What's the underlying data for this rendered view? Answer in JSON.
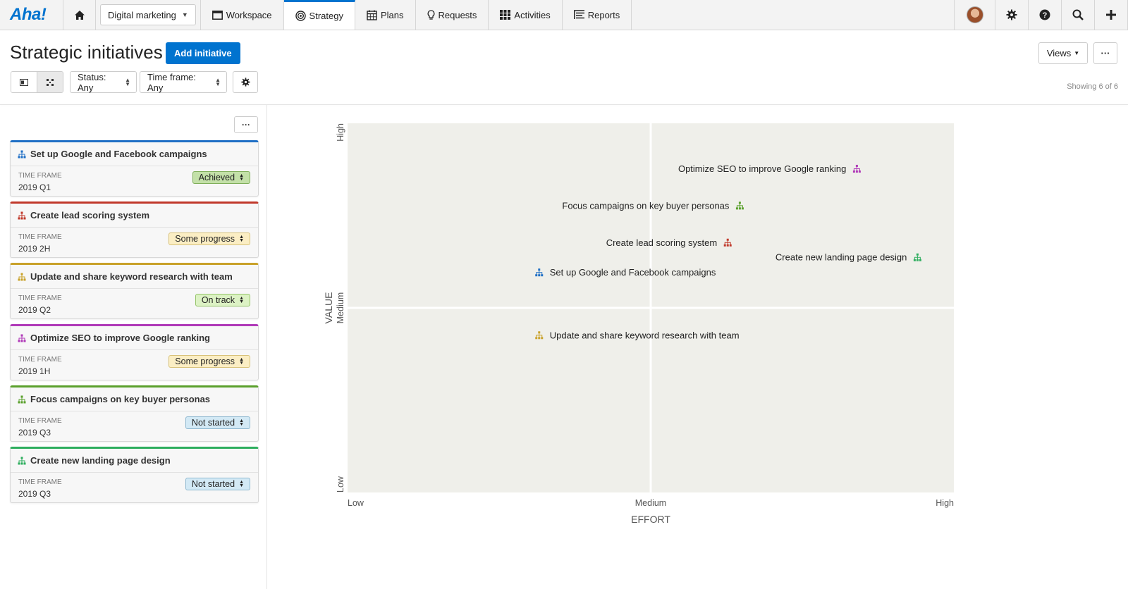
{
  "nav": {
    "logo": "Aha!",
    "workspace": "Digital marketing",
    "tabs": [
      {
        "label": "Workspace",
        "icon": "window-icon"
      },
      {
        "label": "Strategy",
        "icon": "target-icon",
        "active": true
      },
      {
        "label": "Plans",
        "icon": "calendar-icon"
      },
      {
        "label": "Requests",
        "icon": "lightbulb-icon"
      },
      {
        "label": "Activities",
        "icon": "grid-icon"
      },
      {
        "label": "Reports",
        "icon": "report-icon"
      }
    ]
  },
  "header": {
    "title": "Strategic initiatives",
    "add_button": "Add initiative",
    "views_button": "Views",
    "more_button": "···",
    "status_filter": "Status: Any",
    "timeframe_filter": "Time frame: Any",
    "showing": "Showing 6 of 6"
  },
  "panel": {
    "more_button": "···",
    "timeframe_label": "TIME FRAME"
  },
  "initiatives": [
    {
      "name": "Set up Google and Facebook campaigns",
      "time_frame": "2019 Q1",
      "status": "Achieved",
      "color": "#1f6fc5",
      "status_bg": "#c3e0a8",
      "status_border": "#7fae5a"
    },
    {
      "name": "Create lead scoring system",
      "time_frame": "2019 2H",
      "status": "Some progress",
      "color": "#c0392b",
      "status_bg": "#fbeec4",
      "status_border": "#d8c27a"
    },
    {
      "name": "Update and share keyword research with team",
      "time_frame": "2019 Q2",
      "status": "On track",
      "color": "#c9a22a",
      "status_bg": "#dcf2c4",
      "status_border": "#95c46a"
    },
    {
      "name": "Optimize SEO to improve Google ranking",
      "time_frame": "2019 1H",
      "status": "Some progress",
      "color": "#b03ab8",
      "status_bg": "#fbeec4",
      "status_border": "#d8c27a"
    },
    {
      "name": "Focus campaigns on key buyer personas",
      "time_frame": "2019 Q3",
      "status": "Not started",
      "color": "#5aa02c",
      "status_bg": "#d3e9f5",
      "status_border": "#8fb8d0"
    },
    {
      "name": "Create new landing page design",
      "time_frame": "2019 Q3",
      "status": "Not started",
      "color": "#2eae5e",
      "status_bg": "#d3e9f5",
      "status_border": "#8fb8d0"
    }
  ],
  "chart_data": {
    "type": "scatter",
    "xlabel": "EFFORT",
    "ylabel": "VALUE",
    "x_ticks": [
      "Low",
      "Medium",
      "High"
    ],
    "y_ticks": [
      "Low",
      "Medium",
      "High"
    ],
    "xlim": [
      0,
      1
    ],
    "ylim": [
      0,
      1
    ],
    "grid": "quadrants",
    "points": [
      {
        "label": "Optimize SEO to improve Google ranking",
        "x": 0.84,
        "y": 0.877,
        "color": "#b03ab8",
        "label_side": "left"
      },
      {
        "label": "Focus campaigns on key buyer personas",
        "x": 0.647,
        "y": 0.777,
        "color": "#5aa02c",
        "label_side": "left"
      },
      {
        "label": "Create lead scoring system",
        "x": 0.627,
        "y": 0.677,
        "color": "#c0392b",
        "label_side": "left"
      },
      {
        "label": "Create new landing page design",
        "x": 0.94,
        "y": 0.637,
        "color": "#2eae5e",
        "label_side": "left"
      },
      {
        "label": "Set up Google and Facebook campaigns",
        "x": 0.316,
        "y": 0.596,
        "color": "#1f6fc5",
        "label_side": "right"
      },
      {
        "label": "Update and share keyword research with team",
        "x": 0.316,
        "y": 0.426,
        "color": "#c9a22a",
        "label_side": "right"
      }
    ]
  }
}
